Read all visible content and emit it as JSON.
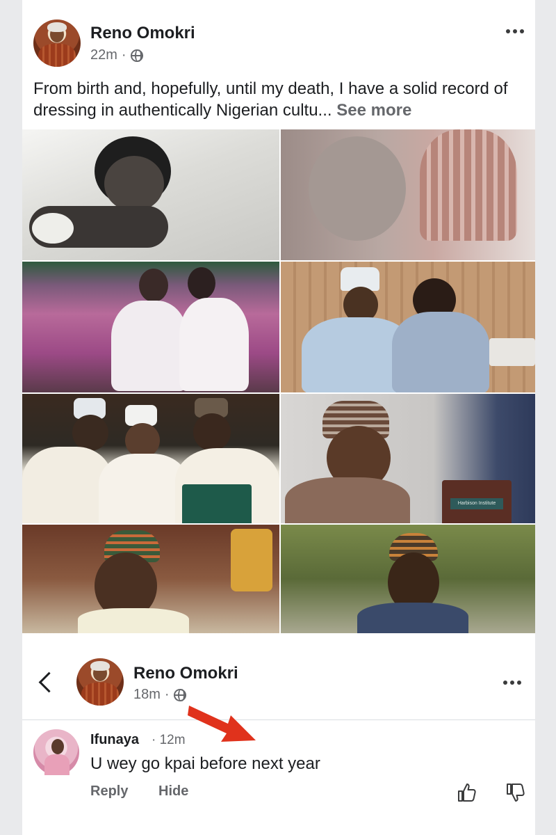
{
  "post": {
    "author": "Reno Omokri",
    "time": "22m",
    "separator": "·",
    "text": "From birth and, hopefully, until my death, I have a solid record of dressing in authentically Nigerian cultu...",
    "see_more": "See more"
  },
  "comment_view": {
    "author": "Reno Omokri",
    "time": "18m",
    "separator": "·"
  },
  "comment": {
    "author": "Ifunaya",
    "time": "· 12m",
    "text": "U wey go kpai before next year",
    "actions": [
      "Reply",
      "Hide"
    ]
  },
  "photo_labels": {
    "podium_sign": "Harbison Institute"
  },
  "colors": {
    "arrow": "#e0321c",
    "secondary_text": "#65676b",
    "primary_text": "#1c1e21"
  },
  "icons": [
    "globe-icon",
    "more-options-icon",
    "back-chevron-icon",
    "like-icon",
    "dislike-icon",
    "red-arrow-icon"
  ]
}
